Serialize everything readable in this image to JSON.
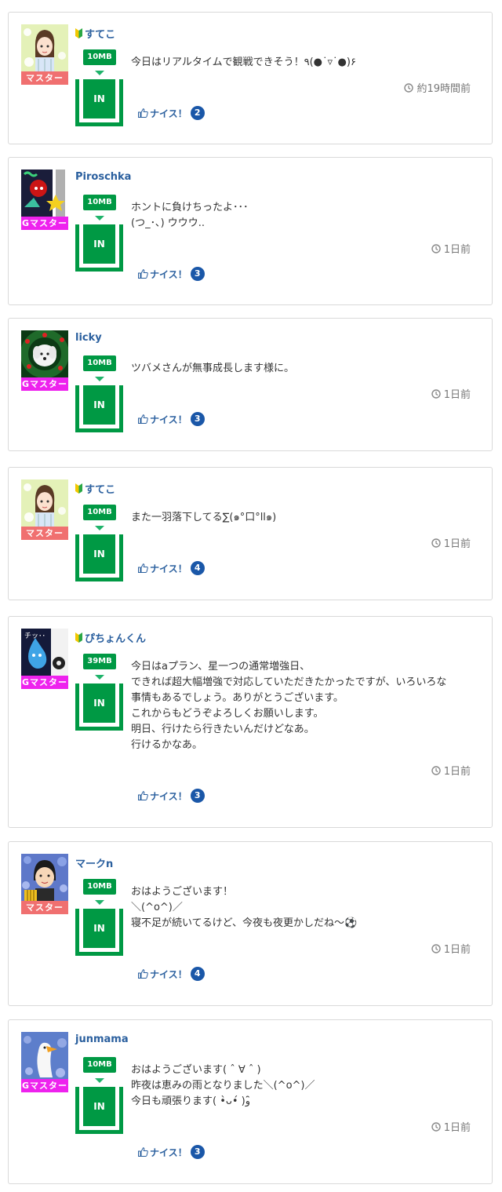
{
  "badge_in_label": "IN",
  "nice_label": "ナイス！",
  "colors": {
    "accent_green": "#009944",
    "link_blue": "#2a5f9e",
    "count_blue": "#1a57a8",
    "master_pink": "#f07070",
    "gmaster_magenta": "#ee22ee"
  },
  "posts": [
    {
      "username": "すてこ",
      "beginner_mark": true,
      "rank": "マスター",
      "rank_type": "master",
      "data_badge": "10MB",
      "message": [
        "今日はリアルタイムで観戦できそう！٩(●˙▿˙●)۶"
      ],
      "time": "約19時間前",
      "nice_count": "2",
      "avatar_icon": "girl-avatar-icon"
    },
    {
      "username": "Piroschka",
      "beginner_mark": false,
      "rank": "Gマスター",
      "rank_type": "gmaster",
      "data_badge": "10MB",
      "message": [
        "ホントに負けちったよ･･･",
        "(つ_･､) ウウウ.."
      ],
      "time": "1日前",
      "nice_count": "3",
      "avatar_icon": "character-avatar-icon"
    },
    {
      "username": "licky",
      "beginner_mark": false,
      "rank": "Gマスター",
      "rank_type": "gmaster",
      "data_badge": "10MB",
      "message": [
        "ツバメさんが無事成長します様に。"
      ],
      "time": "1日前",
      "nice_count": "3",
      "avatar_icon": "dog-wreath-avatar-icon"
    },
    {
      "username": "すてこ",
      "beginner_mark": true,
      "rank": "マスター",
      "rank_type": "master",
      "data_badge": "10MB",
      "message": [
        "また一羽落下してる∑(๑°口°ll๑)"
      ],
      "time": "1日前",
      "nice_count": "4",
      "avatar_icon": "girl-avatar-icon"
    },
    {
      "username": "ぴちょんくん",
      "beginner_mark": true,
      "rank": "Gマスター",
      "rank_type": "gmaster",
      "data_badge": "39MB",
      "message": [
        "今日はaプラン、星一つの通常増強日、",
        "できれば超大幅増強で対応していただきたかったですが、いろいろな",
        "事情もあるでしょう。ありがとうございます。",
        "これからもどうぞよろしくお願いします。",
        "明日、行けたら行きたいんだけどなあ。",
        "行けるかなあ。"
      ],
      "time": "1日前",
      "nice_count": "3",
      "avatar_icon": "drop-character-avatar-icon"
    },
    {
      "username": "マークn",
      "beginner_mark": false,
      "rank": "マスター",
      "rank_type": "master",
      "data_badge": "10MB",
      "message": [
        "おはようございます！",
        "＼(^ο^)／",
        "寝不足が続いてるけど、今夜も夜更かしだね〜⚽"
      ],
      "time": "1日前",
      "nice_count": "4",
      "avatar_icon": "man-flowers-avatar-icon"
    },
    {
      "username": "junmama",
      "beginner_mark": false,
      "rank": "Gマスター",
      "rank_type": "gmaster",
      "data_badge": "10MB",
      "message": [
        "おはようございます( ˆ ∀ ˆ )",
        "昨夜は恵みの雨となりました＼(^ο^)／",
        "今日も頑張ります( •̀ᴗ•́ )و ̑̑"
      ],
      "time": "1日前",
      "nice_count": "3",
      "avatar_icon": "swan-avatar-icon"
    }
  ]
}
